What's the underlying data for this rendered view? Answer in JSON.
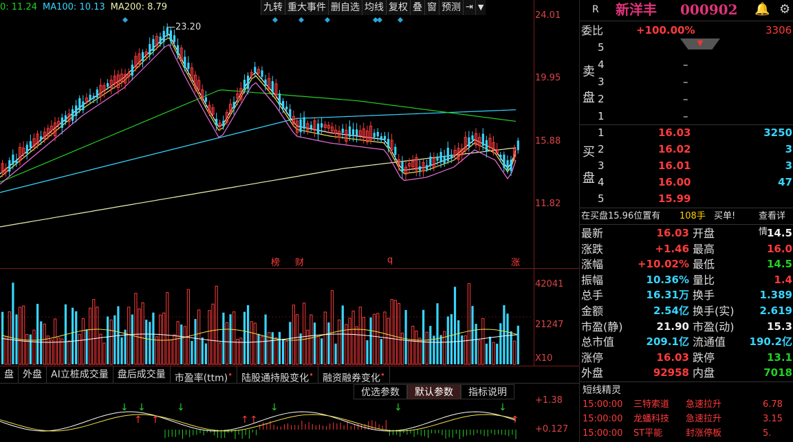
{
  "ma_legend": [
    {
      "text": "0: 11.24",
      "color": "#23d023"
    },
    {
      "text": "MA100: 10.13",
      "color": "#37d6ff"
    },
    {
      "text": "MA200: 8.79",
      "color": "#f0f0b0"
    }
  ],
  "toolbar": [
    "九转",
    "重大事件",
    "删自选",
    "均线",
    "复权",
    "叠",
    "窗",
    "预测"
  ],
  "price_axis": [
    "24.01",
    "19.95",
    "15.88",
    "11.82"
  ],
  "peak_label": "23.20",
  "event_marks": [
    "榜",
    "财",
    "q",
    "涨"
  ],
  "volume_axis": [
    "42041",
    "21247",
    "X10"
  ],
  "bottom_tabs": [
    "盘",
    "外盘",
    "AI立桩成交量",
    "盘后成交量",
    "市盈率(ttm)",
    "陆股通持股变化",
    "融资融券变化"
  ],
  "sub_tabs": [
    "优选参数",
    "默认参数",
    "指标说明"
  ],
  "indicator_axis": [
    "+1.38",
    "+0.127"
  ],
  "stock": {
    "r_label": "R",
    "name": "新洋丰",
    "code": "000902"
  },
  "ratio": {
    "label": "委比",
    "value": "+100.00%",
    "diff": "3306"
  },
  "sell_label": "卖盘",
  "buy_label": "买盘",
  "sell_levels": [
    {
      "level": "5",
      "price": "",
      "vol": ""
    },
    {
      "level": "4",
      "price": "–",
      "vol": ""
    },
    {
      "level": "3",
      "price": "–",
      "vol": ""
    },
    {
      "level": "2",
      "price": "–",
      "vol": ""
    },
    {
      "level": "1",
      "price": "–",
      "vol": ""
    }
  ],
  "buy_levels": [
    {
      "level": "1",
      "price": "16.03",
      "vol": "3250"
    },
    {
      "level": "2",
      "price": "16.02",
      "vol": "3"
    },
    {
      "level": "3",
      "price": "16.01",
      "vol": "3"
    },
    {
      "level": "4",
      "price": "16.00",
      "vol": "47"
    },
    {
      "level": "5",
      "price": "15.99",
      "vol": ""
    }
  ],
  "bid_info": {
    "text": "在买盘15.96位置有",
    "count": "108手",
    "action": "买单!",
    "link": "查看详情"
  },
  "stats": [
    {
      "l1": "最新",
      "v1": "16.03",
      "c1": "red",
      "l2": "开盘",
      "v2": "14.5",
      "c2": "white"
    },
    {
      "l1": "涨跌",
      "v1": "+1.46",
      "c1": "red",
      "l2": "最高",
      "v2": "16.0",
      "c2": "red"
    },
    {
      "l1": "涨幅",
      "v1": "+10.02%",
      "c1": "red",
      "l2": "最低",
      "v2": "14.5",
      "c2": "green"
    },
    {
      "l1": "振幅",
      "v1": "10.36%",
      "c1": "cyan",
      "l2": "量比",
      "v2": "1.4",
      "c2": "red"
    },
    {
      "l1": "总手",
      "v1": "16.31万",
      "c1": "cyan",
      "l2": "换手",
      "v2": "1.389",
      "c2": "cyan"
    },
    {
      "l1": "金额",
      "v1": "2.54亿",
      "c1": "cyan",
      "l2": "换手(实)",
      "v2": "2.619",
      "c2": "cyan"
    },
    {
      "l1": "市盈(静)",
      "v1": "21.90",
      "c1": "white",
      "l2": "市盈(动)",
      "v2": "15.3",
      "c2": "white"
    },
    {
      "l1": "总市值",
      "v1": "209.1亿",
      "c1": "cyan",
      "l2": "流通值",
      "v2": "190.2亿",
      "c2": "cyan"
    },
    {
      "l1": "涨停",
      "v1": "16.03",
      "c1": "red",
      "l2": "跌停",
      "v2": "13.1",
      "c2": "green"
    },
    {
      "l1": "外盘",
      "v1": "92958",
      "c1": "red",
      "l2": "内盘",
      "v2": "7018",
      "c2": "green"
    }
  ],
  "news_title": "短线精灵",
  "news": [
    {
      "time": "15:00:00",
      "name": "三特索道",
      "event": "急速拉升",
      "val": "6.78"
    },
    {
      "time": "15:00:00",
      "name": "龙蟠科技",
      "event": "急速拉升",
      "val": "3.15"
    },
    {
      "time": "15:00:00",
      "name": "ST平能",
      "event": "封涨停板",
      "val": "5."
    }
  ]
}
